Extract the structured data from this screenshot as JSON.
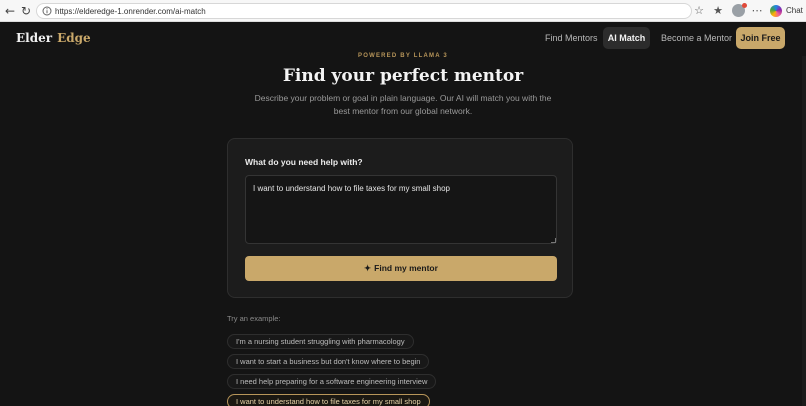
{
  "browser": {
    "url": "https://elderedge-1.onrender.com/ai-match",
    "chat_label": "Chat"
  },
  "header": {
    "brand_first": "Elder",
    "brand_second": "Edge",
    "nav": {
      "find_mentors": "Find Mentors",
      "ai_match": "AI Match",
      "become_mentor": "Become a Mentor",
      "join": "Join Free"
    }
  },
  "hero": {
    "eyebrow": "POWERED BY LLAMA 3",
    "title": "Find your perfect mentor",
    "subtitle": "Describe your problem or goal in plain language. Our AI will match you with the best mentor from our global network."
  },
  "form": {
    "label": "What do you need help with?",
    "value": "I want to understand how to file taxes for my small shop",
    "button_icon": "✦",
    "button_label": "Find my mentor"
  },
  "examples": {
    "label": "Try an example:",
    "items": [
      "I'm a nursing student struggling with pharmacology",
      "I want to start a business but don't know where to begin",
      "I need help preparing for a software engineering interview",
      "I want to understand how to file taxes for my small shop"
    ],
    "selected_index": 3
  },
  "colors": {
    "accent": "#c9a86a",
    "background": "#141414"
  }
}
